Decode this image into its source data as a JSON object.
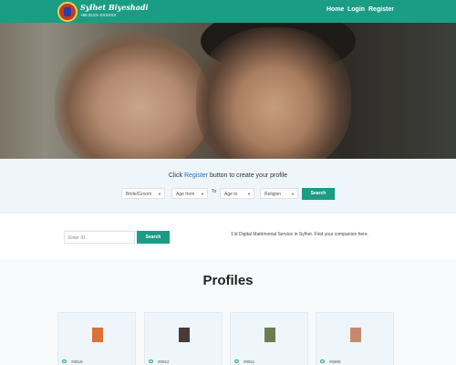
{
  "header": {
    "logo_title": "Sylhet Biyeshadi",
    "logo_subtitle": "+88 01XX-XXXXXX",
    "nav": [
      "Home",
      "Login",
      "Register"
    ]
  },
  "hero": {
    "slides": 2,
    "active_slide": 1
  },
  "search": {
    "cta_prefix": "Click ",
    "cta_link": "Register",
    "cta_suffix": " button to create your profile",
    "gender_select": "Bride/Groom",
    "age_from_select": "Age from",
    "to_label": "To",
    "age_to_select": "Age to",
    "religion_select": "Religion",
    "button": "Search"
  },
  "id_search": {
    "placeholder": "Enter ID",
    "button": "Search",
    "tagline": "1'st Digital Matrimonial Service in Sylhet. Find your companion here."
  },
  "profiles": {
    "title": "Profiles",
    "cards": [
      {
        "id": "#0918",
        "photo_color": "#d9713a"
      },
      {
        "id": "#0912",
        "photo_color": "#4a3a36"
      },
      {
        "id": "#0911",
        "photo_color": "#6b7d4e"
      },
      {
        "id": "#0909",
        "photo_color": "#c58a6e"
      }
    ]
  },
  "colors": {
    "accent": "#1b9c84",
    "link": "#1e73be",
    "section_bg": "#eef5fb"
  }
}
